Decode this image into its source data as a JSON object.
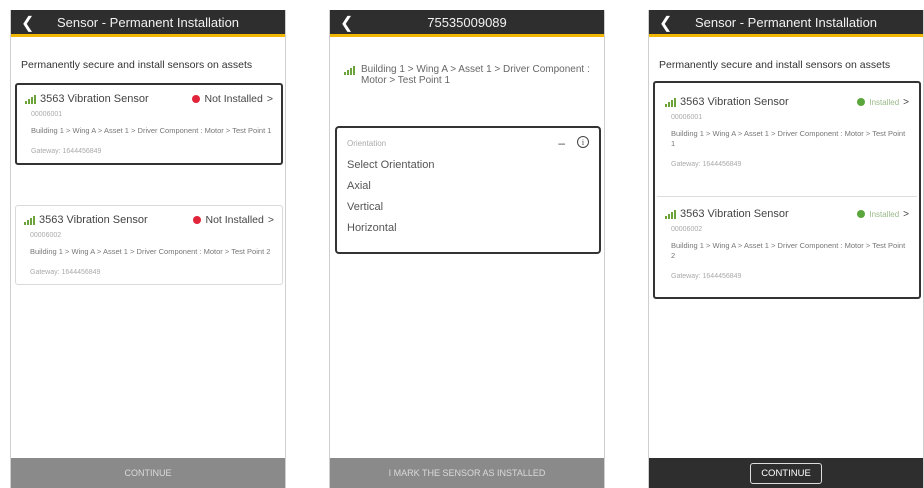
{
  "screen1": {
    "title": "Sensor - Permanent Installation",
    "intro": "Permanently secure and install sensors on assets",
    "cards": [
      {
        "name": "3563 Vibration Sensor",
        "status": "Not Installed",
        "serial": "00006001",
        "path": "Building 1 > Wing A > Asset 1 > Driver Component : Motor > Test Point 1",
        "gateway": "Gateway: 1644456849"
      },
      {
        "name": "3563 Vibration Sensor",
        "status": "Not Installed",
        "serial": "00006002",
        "path": "Building 1 > Wing A > Asset 1 > Driver Component : Motor > Test Point 2",
        "gateway": "Gateway: 1644456849"
      }
    ],
    "continue": "CONTINUE"
  },
  "screen2": {
    "title": "75535009089",
    "path": "Building 1 > Wing A > Asset 1 > Driver Component : Motor > Test Point 1",
    "dropdown_label": "Orientation",
    "options": [
      "Select Orientation",
      "Axial",
      "Vertical",
      "Horizontal"
    ],
    "bottom": "I MARK THE SENSOR AS INSTALLED"
  },
  "screen3": {
    "title": "Sensor - Permanent Installation",
    "intro": "Permanently secure and install sensors on assets",
    "cards": [
      {
        "name": "3563 Vibration Sensor",
        "status": "Installed",
        "serial": "00006001",
        "path": "Building 1 > Wing A > Asset 1 > Driver Component : Motor > Test Point 1",
        "gateway": "Gateway: 1644456849"
      },
      {
        "name": "3563 Vibration Sensor",
        "status": "Installed",
        "serial": "00006002",
        "path": "Building 1 > Wing A > Asset 1 > Driver Component : Motor > Test Point 2",
        "gateway": "Gateway: 1644456849"
      }
    ],
    "continue": "CONTINUE"
  },
  "colors": {
    "accent": "#f2b705",
    "bar": "#2e2e2e",
    "not_installed": "#e0243a",
    "installed": "#5aa63c",
    "signal": "#6ca33a"
  },
  "icons": {
    "back": "chevron-left-icon",
    "signal": "signal-bars-icon",
    "info": "info-icon",
    "collapse": "minus-icon"
  }
}
